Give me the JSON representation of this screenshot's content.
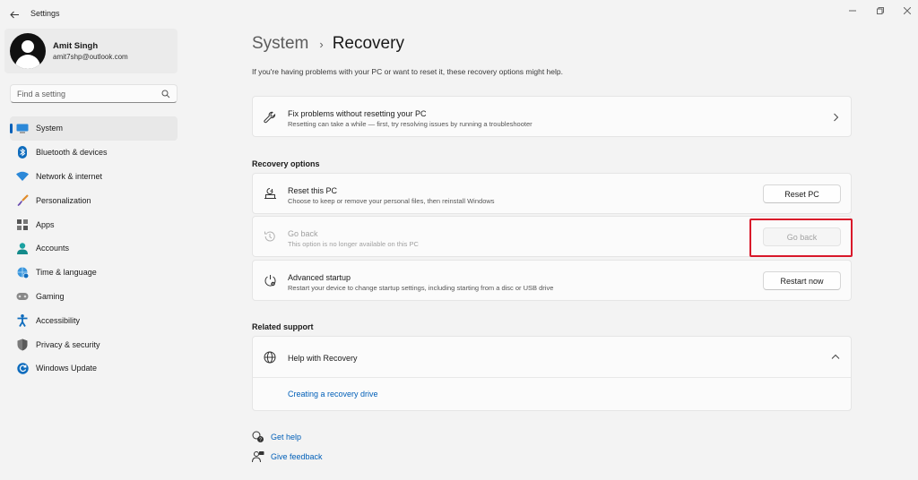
{
  "window": {
    "title": "Settings"
  },
  "profile": {
    "name": "Amit Singh",
    "email": "amit7shp@outlook.com"
  },
  "search": {
    "placeholder": "Find a setting"
  },
  "sidebar": {
    "items": [
      {
        "label": "System",
        "icon": "monitor-icon",
        "active": true
      },
      {
        "label": "Bluetooth & devices",
        "icon": "bluetooth-icon"
      },
      {
        "label": "Network & internet",
        "icon": "wifi-icon"
      },
      {
        "label": "Personalization",
        "icon": "brush-icon"
      },
      {
        "label": "Apps",
        "icon": "apps-icon"
      },
      {
        "label": "Accounts",
        "icon": "person-icon"
      },
      {
        "label": "Time & language",
        "icon": "globe-clock-icon"
      },
      {
        "label": "Gaming",
        "icon": "gamepad-icon"
      },
      {
        "label": "Accessibility",
        "icon": "accessibility-icon"
      },
      {
        "label": "Privacy & security",
        "icon": "shield-icon"
      },
      {
        "label": "Windows Update",
        "icon": "update-icon"
      }
    ]
  },
  "header": {
    "parent": "System",
    "separator": "›",
    "current": "Recovery"
  },
  "intro": "If you're having problems with your PC or want to reset it, these recovery options might help.",
  "fix_card": {
    "title": "Fix problems without resetting your PC",
    "description": "Resetting can take a while — first, try resolving issues by running a troubleshooter"
  },
  "recovery_options": {
    "heading": "Recovery options",
    "reset": {
      "title": "Reset this PC",
      "description": "Choose to keep or remove your personal files, then reinstall Windows",
      "button": "Reset PC"
    },
    "go_back": {
      "title": "Go back",
      "description": "This option is no longer available on this PC",
      "button": "Go back",
      "disabled": true
    },
    "advanced": {
      "title": "Advanced startup",
      "description": "Restart your device to change startup settings, including starting from a disc or USB drive",
      "button": "Restart now"
    }
  },
  "related_support": {
    "heading": "Related support",
    "title": "Help with Recovery",
    "link": "Creating a recovery drive"
  },
  "footer": {
    "get_help": "Get help",
    "give_feedback": "Give feedback"
  },
  "colors": {
    "accent": "#005fb8",
    "highlight": "#d9182a",
    "background": "#f3f3f3"
  }
}
